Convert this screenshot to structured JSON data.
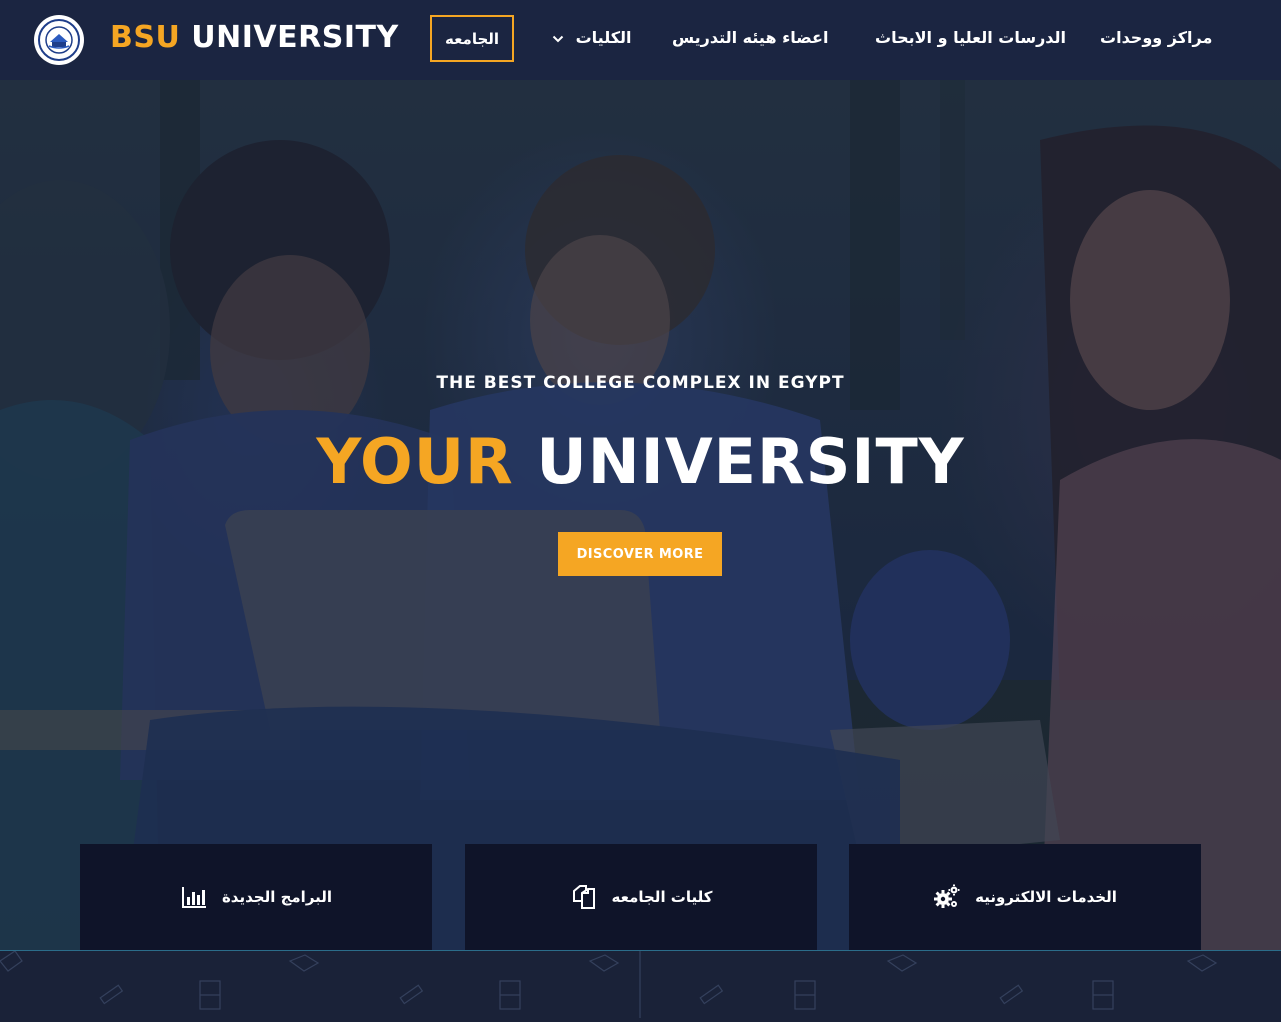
{
  "brand": {
    "primary": "BSU",
    "secondary": "UNIVERSITY"
  },
  "nav": {
    "items": [
      {
        "label": "مراكز ووحدات"
      },
      {
        "label": "الدرسات العليا و الابحاث"
      },
      {
        "label": "اعضاء هيئه التدريس"
      },
      {
        "label": "الكليات"
      },
      {
        "label": "الجامعه"
      }
    ]
  },
  "hero": {
    "kicker": "THE BEST COLLEGE COMPLEX IN EGYPT",
    "title_accent": "YOUR",
    "title_rest": "UNIVERSITY",
    "cta_label": "DISCOVER MORE"
  },
  "features": [
    {
      "label": "البرامج الجديدة",
      "icon": "bar-chart-icon"
    },
    {
      "label": "كليات الجامعه",
      "icon": "copy-files-icon"
    },
    {
      "label": "الخدمات الالكترونيه",
      "icon": "gears-icon"
    }
  ],
  "colors": {
    "accent": "#f5a623",
    "navbar": "#1b2541",
    "card": "#0f1429"
  }
}
